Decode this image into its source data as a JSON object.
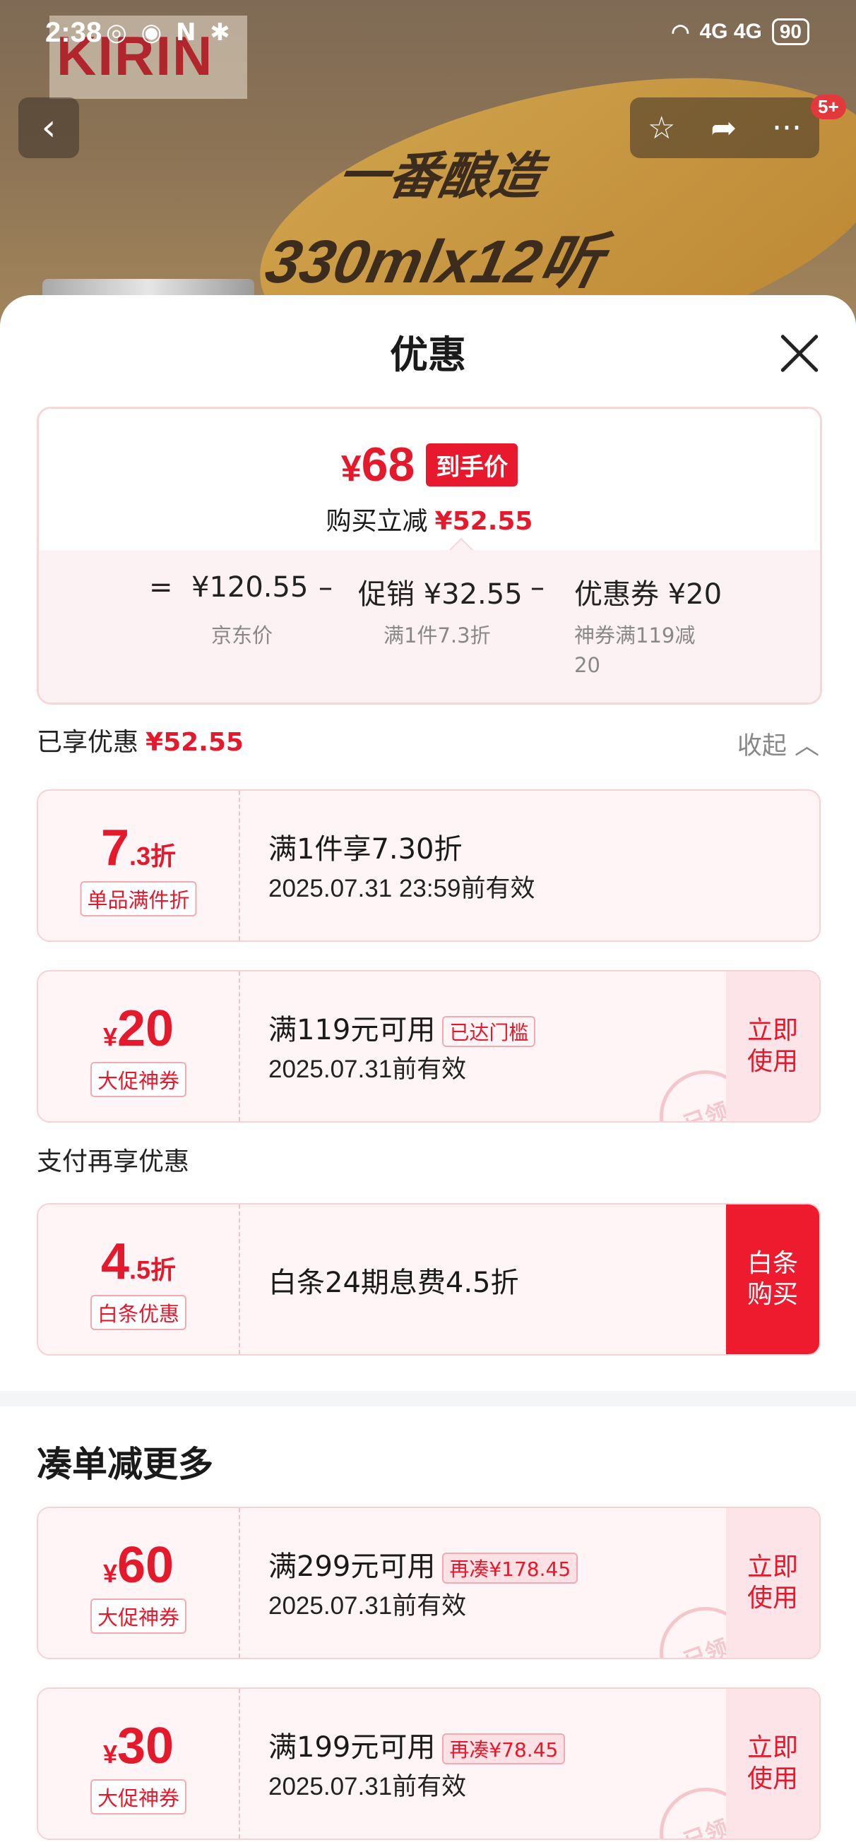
{
  "status_bar": {
    "time": "2:38",
    "left_icons": "◎ ◉ N ✱",
    "network": "4G 4G",
    "battery": "90"
  },
  "banner": {
    "brand": "KIRIN",
    "slogan_line1": "一番酿造",
    "slogan_line2": "330mlx12听"
  },
  "nav": {
    "back_icon": "‹",
    "star_icon": "☆",
    "share_icon": "➦",
    "more_icon": "···",
    "message_badge": "5+"
  },
  "sheet": {
    "title": "优惠"
  },
  "summary": {
    "final_price_symbol": "¥",
    "final_price": "68",
    "final_tag": "到手价",
    "saved_label": "购买立减",
    "saved_value": "¥52.55",
    "equals": "=",
    "jd_price": "¥120.55",
    "jd_label": "京东价",
    "minus1": "–",
    "promo": "促销 ¥32.55",
    "promo_desc": "满1件7.3折",
    "minus2": "–",
    "coupon": "优惠券 ¥20",
    "coupon_desc_line1": "神券满119减",
    "coupon_desc_line2": "20"
  },
  "enjoyed": {
    "label": "已享优惠",
    "value": "¥52.55",
    "collapse": "收起 ︿"
  },
  "coupons": [
    {
      "amount_main": "7",
      "amount_unit": ".3折",
      "tag": "单品满件折",
      "title": "满1件享7.30折",
      "date": "2025.07.31 23:59前有效"
    },
    {
      "amount_prefix": "¥",
      "amount_main": "20",
      "tag": "大促神券",
      "title": "满119元可用",
      "reach": "已达门槛",
      "date": "2025.07.31前有效",
      "use": "立即使用",
      "stamp": "已领"
    }
  ],
  "pay_section": {
    "label": "支付再享优惠",
    "amount_main": "4",
    "amount_unit": ".5折",
    "tag": "白条优惠",
    "title": "白条24期息费4.5折",
    "use": "白条购买"
  },
  "more": {
    "title": "凑单减更多",
    "items": [
      {
        "amount_prefix": "¥",
        "amount_main": "60",
        "tag": "大促神券",
        "title": "满299元可用",
        "reach": "再凑¥178.45",
        "date": "2025.07.31前有效",
        "use": "立即使用",
        "stamp": "已领"
      },
      {
        "amount_prefix": "¥",
        "amount_main": "30",
        "tag": "大促神券",
        "title": "满199元可用",
        "reach": "再凑¥78.45",
        "date": "2025.07.31前有效",
        "use": "立即使用",
        "stamp": "已领"
      }
    ]
  },
  "colors": {
    "accent": "#e4192c",
    "card_bg": "#fff5f6",
    "card_border": "#f7d1d6"
  }
}
